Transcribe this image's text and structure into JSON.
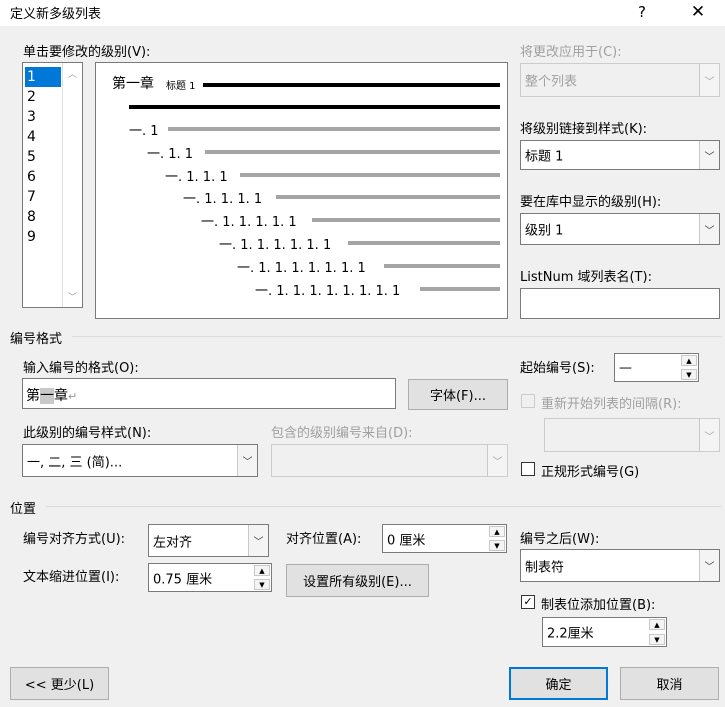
{
  "window": {
    "title": "定义新多级列表",
    "help": "?",
    "close": "✕"
  },
  "levels": {
    "label": "单击要修改的级别(V):",
    "items": [
      "1",
      "2",
      "3",
      "4",
      "5",
      "6",
      "7",
      "8",
      "9"
    ],
    "selected": "1"
  },
  "preview": {
    "line1_prefix": "第一章",
    "line1_style": "标题 1",
    "rows": [
      "一. 1",
      "一. 1. 1",
      "一. 1. 1. 1",
      "一. 1. 1. 1. 1",
      "一. 1. 1. 1. 1. 1",
      "一. 1. 1. 1. 1. 1. 1",
      "一. 1. 1. 1. 1. 1. 1. 1",
      "一. 1. 1. 1. 1. 1. 1. 1. 1"
    ]
  },
  "apply_to": {
    "label": "将更改应用于(C):",
    "value": "整个列表"
  },
  "link_style": {
    "label": "将级别链接到样式(K):",
    "value": "标题 1"
  },
  "gallery_level": {
    "label": "要在库中显示的级别(H):",
    "value": "级别 1"
  },
  "listnum": {
    "label": "ListNum 域列表名(T):",
    "value": ""
  },
  "number_format": {
    "group_label": "编号格式",
    "format_label": "输入编号的格式(O):",
    "format_value_a": "第",
    "format_value_hl": "一",
    "format_value_b": "章",
    "pilcrow": "↵",
    "font_button": "字体(F)...",
    "start_label": "起始编号(S):",
    "start_value": "—",
    "restart_label": "重新开始列表的间隔(R):",
    "style_label": "此级别的编号样式(N):",
    "style_value": "一, 二, 三 (简)...",
    "include_label": "包含的级别编号来自(D):",
    "legal_label": "正规形式编号(G)"
  },
  "position": {
    "group_label": "位置",
    "align_label": "编号对齐方式(U):",
    "align_value": "左对齐",
    "align_at_label": "对齐位置(A):",
    "align_at_value": "0 厘米",
    "indent_label": "文本缩进位置(I):",
    "indent_value": "0.75 厘米",
    "set_all_button": "设置所有级别(E)...",
    "follow_label": "编号之后(W):",
    "follow_value": "制表符",
    "tab_label": "制表位添加位置(B):",
    "tab_value": "2.2厘米"
  },
  "footer": {
    "less_button": "<< 更少(L)",
    "ok_button": "确定",
    "cancel_button": "取消"
  }
}
